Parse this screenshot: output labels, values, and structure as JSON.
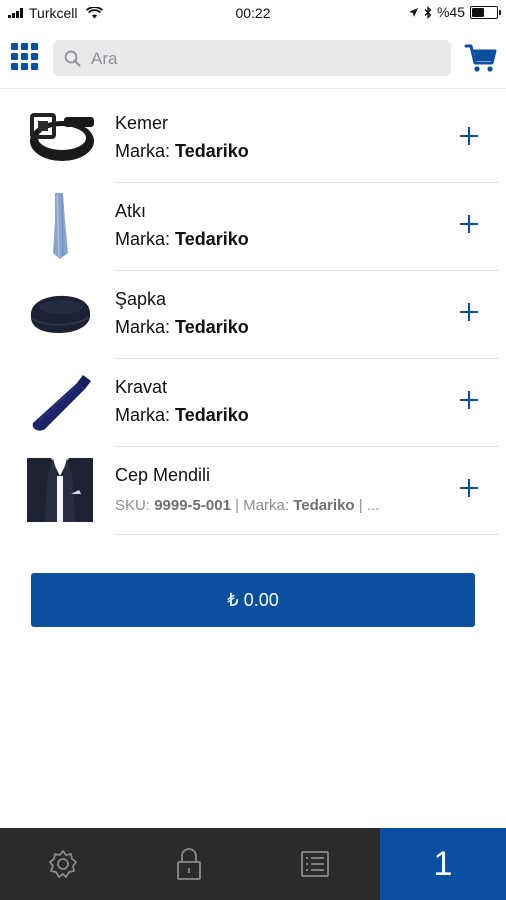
{
  "status_bar": {
    "carrier": "Turkcell",
    "time": "00:22",
    "battery": "%45",
    "battery_level": 0.45
  },
  "header": {
    "menu_icon": "grid-icon",
    "search": {
      "placeholder": "Ara",
      "icon": "search-icon"
    },
    "cart_icon": "cart-icon"
  },
  "products": [
    {
      "name": "Kemer",
      "brand_label": "Marka:",
      "brand": "Tedariko",
      "image": "belt-icon"
    },
    {
      "name": "Atkı",
      "brand_label": "Marka:",
      "brand": "Tedariko",
      "image": "scarf-icon"
    },
    {
      "name": "Şapka",
      "brand_label": "Marka:",
      "brand": "Tedariko",
      "image": "hat-icon"
    },
    {
      "name": "Kravat",
      "brand_label": "Marka:",
      "brand": "Tedariko",
      "image": "tie-icon"
    },
    {
      "name": "Cep Mendili",
      "sku_label": "SKU:",
      "sku": "9999-5-001",
      "sep1": "|",
      "brand_label": "Marka:",
      "brand": "Tedariko",
      "sep2": "| ...",
      "image": "suit-icon"
    }
  ],
  "total_button": {
    "label": "₺ 0.00"
  },
  "tab_bar": {
    "settings_icon": "gear-icon",
    "lock_icon": "lock-icon",
    "list_icon": "list-icon",
    "count": "1"
  },
  "colors": {
    "accent": "#0b4fa0",
    "tab_bar": "#2b2b2b"
  }
}
